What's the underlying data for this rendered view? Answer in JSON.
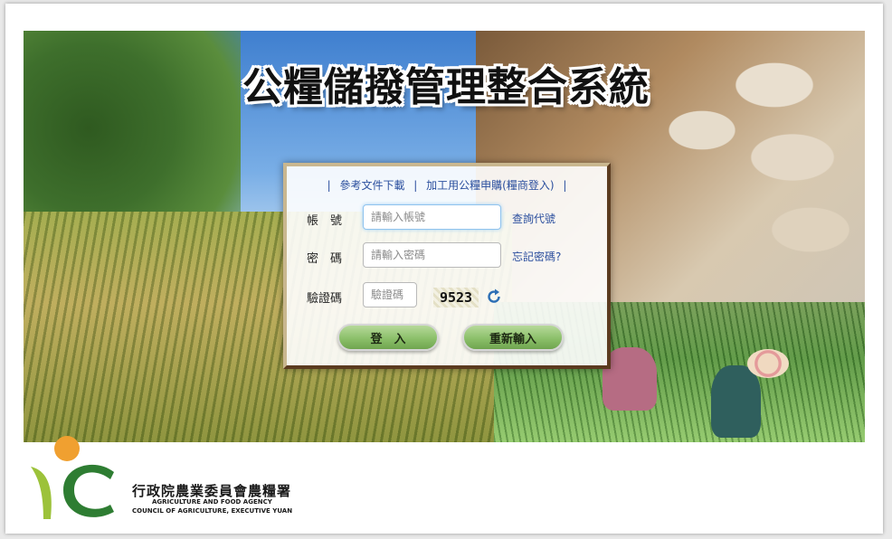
{
  "page": {
    "title": "公糧儲撥管理整合系統"
  },
  "links": {
    "doc_download": "參考文件下載",
    "processing_purchase": "加工用公糧申購(糧商登入)",
    "separator": "|"
  },
  "form": {
    "account_label": "帳　號",
    "account_placeholder": "請輸入帳號",
    "account_value": "",
    "query_code_link": "查詢代號",
    "password_label": "密　碼",
    "password_placeholder": "請輸入密碼",
    "password_value": "",
    "forgot_password_link": "忘記密碼?",
    "captcha_label": "驗證碼",
    "captcha_placeholder": "驗證碼",
    "captcha_value": "",
    "captcha_image_text": "9523",
    "login_button": "登　入",
    "reset_button": "重新輸入"
  },
  "footer": {
    "org_name_zh": "行政院農業委員會農糧署",
    "org_name_en_line1": "AGRICULTURE AND FOOD AGENCY",
    "org_name_en_line2": "COUNCIL OF AGRICULTURE, EXECUTIVE YUAN"
  },
  "colors": {
    "link": "#2b4f9e",
    "button_green": "#8cc06a",
    "logo_orange": "#f0a030",
    "logo_green": "#2e7d32"
  },
  "icons": {
    "refresh": "refresh-icon",
    "logo": "agency-logo"
  }
}
